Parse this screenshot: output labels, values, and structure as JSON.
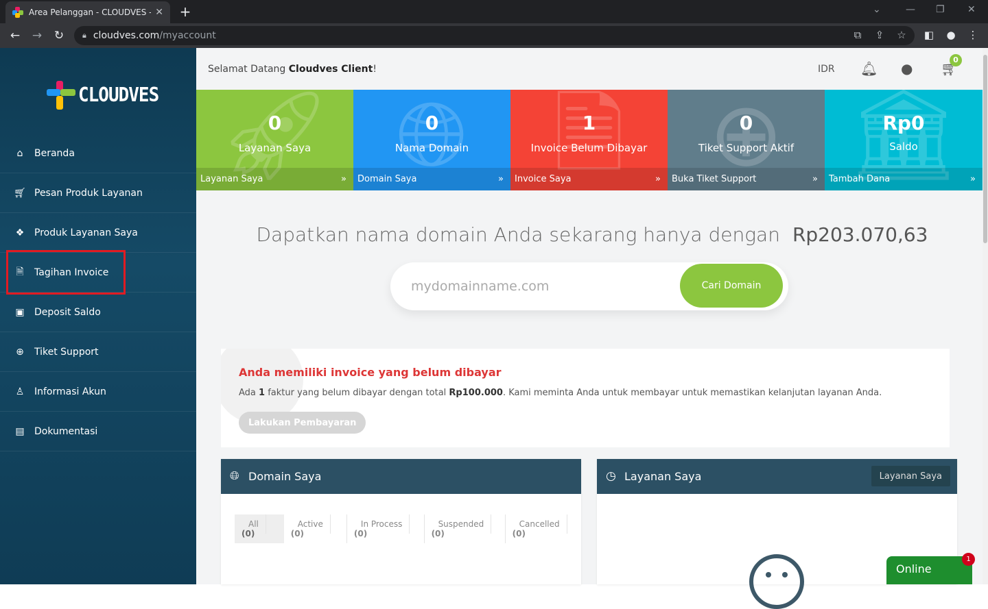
{
  "browser": {
    "tab_title": "Area Pelanggan - CLOUDVES - Sc",
    "url_domain": "cloudves.com",
    "url_path": "/myaccount"
  },
  "sidebar": {
    "logo": "CLOUDVES",
    "items": [
      {
        "label": "Beranda",
        "icon": "home-icon"
      },
      {
        "label": "Pesan Produk Layanan",
        "icon": "cart-icon"
      },
      {
        "label": "Produk Layanan Saya",
        "icon": "cubes-icon"
      },
      {
        "label": "Tagihan Invoice",
        "icon": "file-icon"
      },
      {
        "label": "Deposit Saldo",
        "icon": "money-icon"
      },
      {
        "label": "Tiket Support",
        "icon": "lifebuoy-icon"
      },
      {
        "label": "Informasi Akun",
        "icon": "user-icon"
      },
      {
        "label": "Dokumentasi",
        "icon": "book-icon"
      }
    ]
  },
  "topbar": {
    "welcome_prefix": "Selamat Datang ",
    "welcome_name": "Cloudves Client",
    "welcome_suffix": "!",
    "currency": "IDR",
    "cart_count": "0"
  },
  "tiles": [
    {
      "value": "0",
      "label": "Layanan Saya",
      "footer": "Layanan Saya",
      "color": "#8cc63f"
    },
    {
      "value": "0",
      "label": "Nama Domain",
      "footer": "Domain Saya",
      "color": "#2196f3"
    },
    {
      "value": "1",
      "label": "Invoice Belum Dibayar",
      "footer": "Invoice Saya",
      "color": "#f44336"
    },
    {
      "value": "0",
      "label": "Tiket Support Aktif",
      "footer": "Buka Tiket Support",
      "color": "#607d8b"
    },
    {
      "value": "Rp0",
      "label": "Saldo",
      "footer": "Tambah Dana",
      "color": "#00bcd4"
    }
  ],
  "tile_arrow": "»",
  "domain_search": {
    "headline": "Dapatkan nama domain Anda sekarang hanya dengan",
    "price": "Rp203.070,63",
    "placeholder": "mydomainname.com",
    "button": "Cari Domain"
  },
  "alert": {
    "title": "Anda memiliki invoice yang belum dibayar",
    "desc_1": "Ada ",
    "count": "1",
    "desc_2": " faktur yang belum dibayar dengan total ",
    "amount": "Rp100.000",
    "desc_3": ". Kami meminta Anda untuk membayar untuk memastikan kelanjutan layanan Anda.",
    "button": "Lakukan Pembayaran"
  },
  "domain_panel": {
    "title": "Domain Saya",
    "filters": [
      {
        "label": "All",
        "count": "(0)"
      },
      {
        "label": "Active",
        "count": "(0)"
      },
      {
        "label": "In Process",
        "count": "(0)"
      },
      {
        "label": "Suspended",
        "count": "(0)"
      },
      {
        "label": "Cancelled",
        "count": "(0)"
      }
    ]
  },
  "service_panel": {
    "title": "Layanan Saya",
    "button": "Layanan Saya"
  },
  "chat": {
    "label": "Online",
    "badge": "1"
  }
}
